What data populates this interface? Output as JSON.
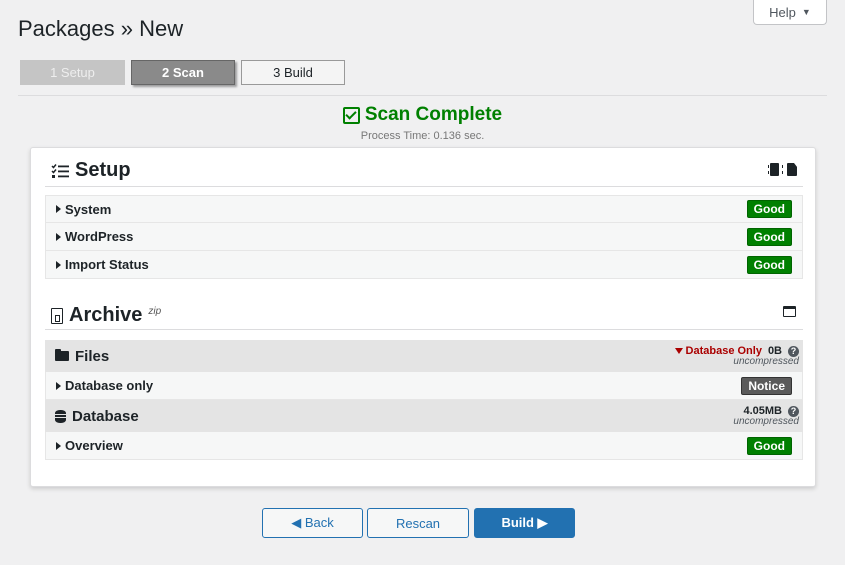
{
  "header": {
    "title": "Packages » New",
    "help_label": "Help",
    "help_caret": "▼"
  },
  "steps": [
    {
      "label": "1 Setup",
      "state": "done"
    },
    {
      "label": "2 Scan",
      "state": "active"
    },
    {
      "label": "3 Build",
      "state": "pending"
    }
  ],
  "scan": {
    "title": "Scan Complete",
    "process_time": "Process Time: 0.136 sec."
  },
  "setup": {
    "title": "Setup",
    "rows": [
      {
        "label": "System",
        "status": "Good"
      },
      {
        "label": "WordPress",
        "status": "Good"
      },
      {
        "label": "Import Status",
        "status": "Good"
      }
    ]
  },
  "archive": {
    "title": "Archive",
    "type": "zip",
    "files": {
      "title": "Files",
      "filter": "Database Only",
      "size": "0B",
      "size_note": "uncompressed",
      "row": {
        "label": "Database only",
        "status": "Notice"
      }
    },
    "database": {
      "title": "Database",
      "size": "4.05MB",
      "size_note": "uncompressed",
      "row": {
        "label": "Overview",
        "status": "Good"
      }
    }
  },
  "actions": {
    "back": "◀ Back",
    "rescan": "Rescan",
    "build": "Build ▶"
  },
  "colors": {
    "good": "#008000",
    "notice": "#5a5a5a",
    "primary": "#2271b1",
    "filter": "#aa0000",
    "scan_complete": "#008000"
  }
}
